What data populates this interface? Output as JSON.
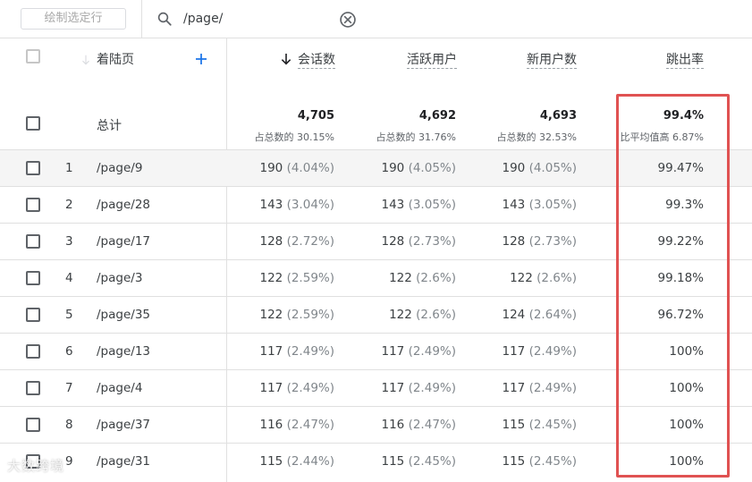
{
  "toolbar": {
    "draw_button": "绘制选定行",
    "search_value": "/page/"
  },
  "table": {
    "headers": {
      "page": "着陆页",
      "sessions": "会话数",
      "active_users": "活跃用户",
      "new_users": "新用户数",
      "bounce_rate": "跳出率"
    },
    "totals": {
      "label": "总计",
      "sessions": "4,705",
      "sessions_sub": "占总数的 30.15%",
      "active_users": "4,692",
      "active_users_sub": "占总数的 31.76%",
      "new_users": "4,693",
      "new_users_sub": "占总数的 32.53%",
      "bounce_rate": "99.4%",
      "bounce_rate_sub": "比平均值高 6.87%"
    },
    "rows": [
      {
        "index": "1",
        "page": "/page/9",
        "sessions": "190",
        "sessions_pct": "(4.04%)",
        "active": "190",
        "active_pct": "(4.05%)",
        "new": "190",
        "new_pct": "(4.05%)",
        "bounce": "99.47%"
      },
      {
        "index": "2",
        "page": "/page/28",
        "sessions": "143",
        "sessions_pct": "(3.04%)",
        "active": "143",
        "active_pct": "(3.05%)",
        "new": "143",
        "new_pct": "(3.05%)",
        "bounce": "99.3%"
      },
      {
        "index": "3",
        "page": "/page/17",
        "sessions": "128",
        "sessions_pct": "(2.72%)",
        "active": "128",
        "active_pct": "(2.73%)",
        "new": "128",
        "new_pct": "(2.73%)",
        "bounce": "99.22%"
      },
      {
        "index": "4",
        "page": "/page/3",
        "sessions": "122",
        "sessions_pct": "(2.59%)",
        "active": "122",
        "active_pct": "(2.6%)",
        "new": "122",
        "new_pct": "(2.6%)",
        "bounce": "99.18%"
      },
      {
        "index": "5",
        "page": "/page/35",
        "sessions": "122",
        "sessions_pct": "(2.59%)",
        "active": "122",
        "active_pct": "(2.6%)",
        "new": "124",
        "new_pct": "(2.64%)",
        "bounce": "96.72%"
      },
      {
        "index": "6",
        "page": "/page/13",
        "sessions": "117",
        "sessions_pct": "(2.49%)",
        "active": "117",
        "active_pct": "(2.49%)",
        "new": "117",
        "new_pct": "(2.49%)",
        "bounce": "100%"
      },
      {
        "index": "7",
        "page": "/page/4",
        "sessions": "117",
        "sessions_pct": "(2.49%)",
        "active": "117",
        "active_pct": "(2.49%)",
        "new": "117",
        "new_pct": "(2.49%)",
        "bounce": "100%"
      },
      {
        "index": "8",
        "page": "/page/37",
        "sessions": "116",
        "sessions_pct": "(2.47%)",
        "active": "116",
        "active_pct": "(2.47%)",
        "new": "115",
        "new_pct": "(2.45%)",
        "bounce": "100%"
      },
      {
        "index": "9",
        "page": "/page/31",
        "sessions": "115",
        "sessions_pct": "(2.44%)",
        "active": "115",
        "active_pct": "(2.45%)",
        "new": "115",
        "new_pct": "(2.45%)",
        "bounce": "100%"
      }
    ]
  },
  "watermark": "大数跨境",
  "colors": {
    "highlight_box": "#e05252",
    "accent_blue": "#1a73e8"
  },
  "icons": {
    "search": "search-icon",
    "clear": "clear-icon",
    "sort_down": "arrow-down-icon",
    "add": "plus-icon"
  }
}
